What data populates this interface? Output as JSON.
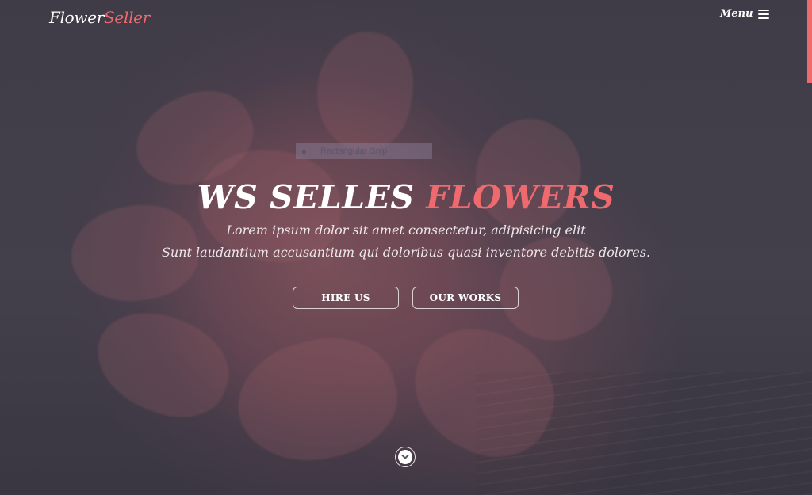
{
  "header": {
    "logo_part1": "Flower",
    "logo_part2": "Seller",
    "menu_label": "Menu"
  },
  "snip_tooltip": {
    "label": "Rectangular Snip"
  },
  "hero": {
    "title_part1": "WS SELLES",
    "title_part2": "FLOWERS",
    "line1": "Lorem ipsum dolor sit amet consectetur, adipisicing elit",
    "line2": "Sunt laudantium accusantium qui doloribus quasi inventore debitis dolores.",
    "buttons": [
      {
        "label": "HIRE US"
      },
      {
        "label": "OUR WORKS"
      }
    ]
  },
  "icons": {
    "menu": "hamburger-icon",
    "scroll_down": "chevron-down-icon"
  },
  "colors": {
    "accent": "#ef6a6e",
    "text": "#ffffff",
    "background": "#45414c"
  }
}
